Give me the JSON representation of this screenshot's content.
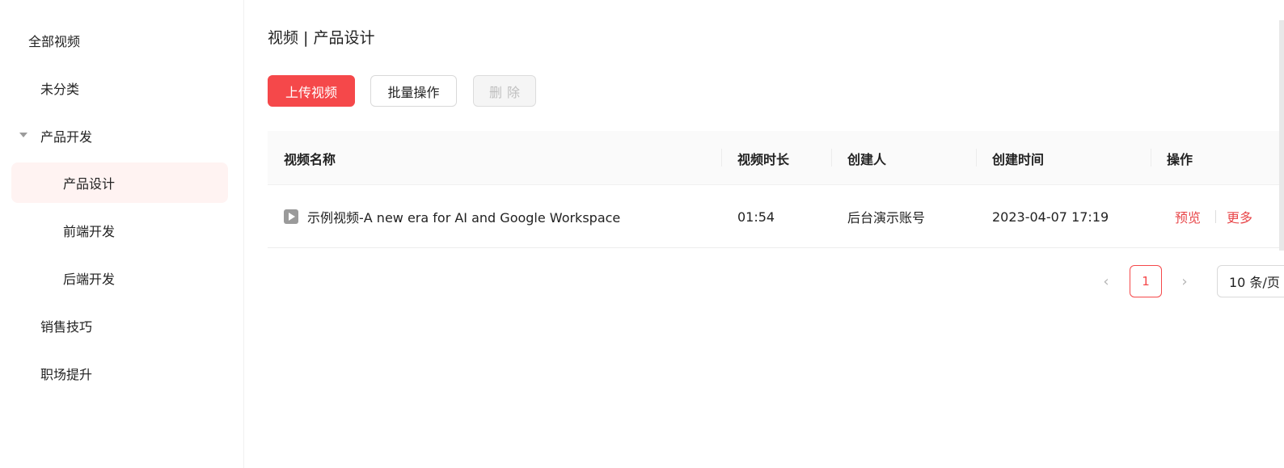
{
  "sidebar": {
    "items": [
      {
        "label": "全部视频"
      },
      {
        "label": "未分类"
      },
      {
        "label": "产品开发"
      },
      {
        "label": "产品设计"
      },
      {
        "label": "前端开发"
      },
      {
        "label": "后端开发"
      },
      {
        "label": "销售技巧"
      },
      {
        "label": "职场提升"
      }
    ]
  },
  "header": {
    "title": "视频 | 产品设计"
  },
  "toolbar": {
    "upload_label": "上传视频",
    "batch_label": "批量操作",
    "delete_label": "删除"
  },
  "table": {
    "columns": [
      "视频名称",
      "视频时长",
      "创建人",
      "创建时间",
      "操作"
    ],
    "rows": [
      {
        "name": "示例视频-A new era for AI and Google Workspace",
        "duration": "01:54",
        "creator": "后台演示账号",
        "created_at": "2023-04-07 17:19",
        "action_preview": "预览",
        "action_more": "更多"
      }
    ]
  },
  "pagination": {
    "prev": "‹",
    "next": "›",
    "current_page": "1",
    "page_size": "10 条/页"
  },
  "colors": {
    "accent": "#f5484a",
    "active_bg": "#fff3f2",
    "link": "#e8474a"
  },
  "icons": {
    "tree_caret": "caret-down-icon",
    "video": "play-icon",
    "prev": "chevron-left-icon",
    "next": "chevron-right-icon"
  }
}
